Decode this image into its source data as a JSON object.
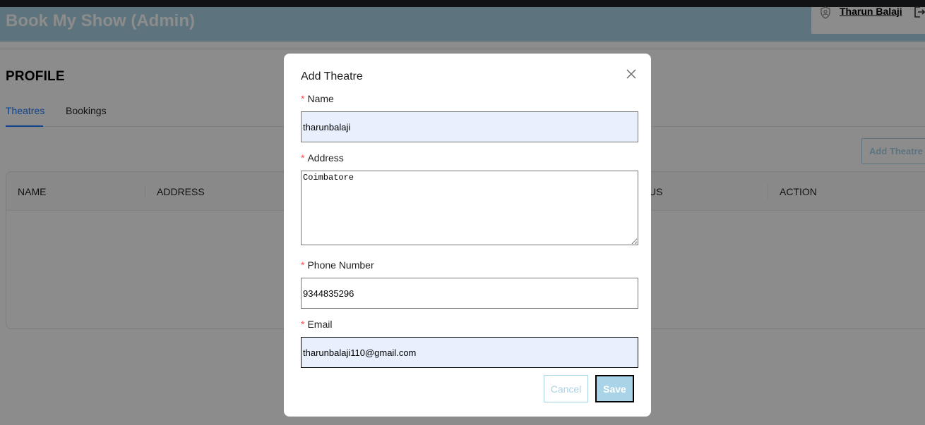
{
  "app": {
    "title": "Book My Show (Admin)",
    "user_name": "Tharun Balaji",
    "brand_color": "#a9d3e6"
  },
  "page": {
    "heading": "PROFILE",
    "tabs": [
      {
        "label": "Theatres",
        "active": true
      },
      {
        "label": "Bookings",
        "active": false
      }
    ],
    "add_button_label": "Add Theatre"
  },
  "table": {
    "columns": [
      "NAME",
      "ADDRESS",
      "US",
      "ACTION"
    ]
  },
  "modal": {
    "title": "Add Theatre",
    "fields": {
      "name": {
        "label": "Name",
        "value": "tharunbalaji"
      },
      "address": {
        "label": "Address",
        "value": "Coimbatore"
      },
      "phone": {
        "label": "Phone Number",
        "value": "9344835296"
      },
      "email": {
        "label": "Email",
        "value": "tharunbalaji110@gmail.com"
      }
    },
    "required_mark": "*",
    "cancel_label": "Cancel",
    "save_label": "Save"
  }
}
